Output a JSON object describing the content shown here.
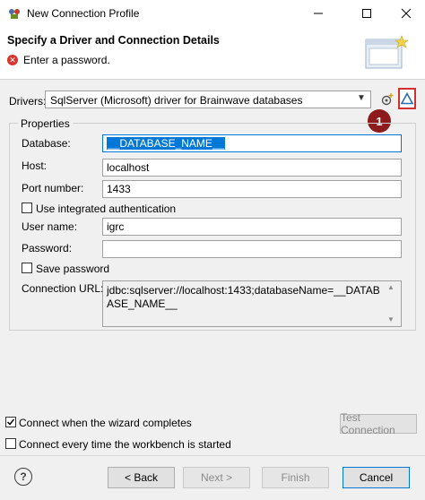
{
  "window": {
    "title": "New Connection Profile"
  },
  "header": {
    "title": "Specify a Driver and Connection Details",
    "message": "Enter a password."
  },
  "drivers": {
    "label": "Drivers:",
    "selected": "SqlServer (Microsoft) driver for Brainwave databases",
    "callout_number": "1"
  },
  "properties": {
    "group_title": "Properties",
    "database_label": "Database:",
    "database_value": "__DATABASE_NAME__",
    "host_label": "Host:",
    "host_value": "localhost",
    "port_label": "Port number:",
    "port_value": "1433",
    "integrated_auth_label": "Use integrated authentication",
    "integrated_auth_checked": false,
    "username_label": "User name:",
    "username_value": "igrc",
    "password_label": "Password:",
    "password_value": "",
    "save_password_label": "Save password",
    "save_password_checked": false,
    "url_label": "Connection URL:",
    "url_value": "jdbc:sqlserver://localhost:1433;databaseName=__DATABASE_NAME__"
  },
  "options": {
    "connect_on_finish_label": "Connect when the wizard completes",
    "connect_on_finish_checked": true,
    "test_connection_label": "Test Connection",
    "connect_every_time_label": "Connect every time the workbench is started",
    "connect_every_time_checked": false
  },
  "footer": {
    "back_label": "< Back",
    "next_label": "Next >",
    "finish_label": "Finish",
    "cancel_label": "Cancel"
  },
  "colors": {
    "error": "#d9352f",
    "accent": "#0078d7",
    "callout": "#8e1b1b",
    "highlight_border": "#d32f2f"
  }
}
